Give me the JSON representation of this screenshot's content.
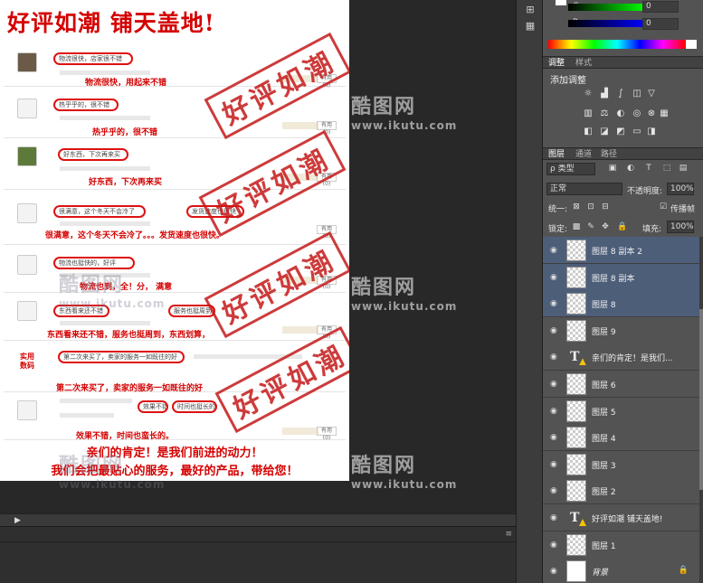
{
  "document": {
    "title": "好评如潮  铺天盖地!",
    "stamp_text": "好评如潮",
    "footer_line1": "亲们的肯定！是我们前进的动力！",
    "footer_line2": "我们会把最贴心的服务，最好的产品，带给您！",
    "reviews": [
      {
        "bubble": "物流很快，店家很不错",
        "note": "物流很快，用起来不错",
        "reply": "有用(0)"
      },
      {
        "bubble": "热乎乎的，很不错",
        "note": "热乎乎的，很不错",
        "reply": "有用(0)"
      },
      {
        "bubble": "好东西，下次再来买",
        "note": "好东西，下次再来买",
        "reply": "有用(0)"
      },
      {
        "bubble": "很满意，这个冬天不会冷了",
        "bubble2": "发货速度也很快",
        "note": "很满意，这个冬天不会冷了。。。发货速度也很快。",
        "reply": "有用(0)"
      },
      {
        "bubble": "物流也挺快的，好评",
        "note": "物流也到，全！分， 满意",
        "reply": "有用(0)"
      },
      {
        "bubble": "东西看来还不错",
        "bubble2": "服务也挺周到",
        "note": "东西看来还不错，服务也挺周到，东西划算，",
        "reply": "有用(0)"
      },
      {
        "bubble": "第二次来买了，卖家的服务一如既往的好",
        "note": "第二次来买了，卖家的服务一如既往的好",
        "reply": "有用(0)"
      },
      {
        "bubble": "效果不错",
        "bubble2": "时间也挺长的",
        "note": "效果不错，时间也蛮长的。",
        "reply": "有用(0)"
      }
    ]
  },
  "watermark": {
    "brand": "酷图网",
    "url": "www.ikutu.com"
  },
  "color_panel": {
    "g_label": "G",
    "g_value": "0",
    "b_label": "B",
    "b_value": "0"
  },
  "adjust_panel": {
    "tabs": [
      "调整",
      "样式"
    ],
    "title": "添加调整"
  },
  "layers_panel": {
    "tabs": [
      "图层",
      "通道",
      "路径"
    ],
    "kind_filter": "ρ 类型",
    "blend_mode": "正常",
    "opacity_label": "不透明度:",
    "opacity_value": "100%",
    "unify_label": "统一:",
    "propagate_label": "传播帧",
    "lock_label": "锁定:",
    "fill_label": "填充:",
    "fill_value": "100%",
    "layers": [
      {
        "name": "图层 8 副本 2",
        "type": "pixel",
        "selected": true
      },
      {
        "name": "图层 8 副本",
        "type": "pixel",
        "selected": true
      },
      {
        "name": "图层 8",
        "type": "pixel",
        "selected": true
      },
      {
        "name": "图层 9",
        "type": "pixel",
        "selected": false
      },
      {
        "name": "亲们的肯定！是我们...",
        "type": "text",
        "selected": false
      },
      {
        "name": "图层 6",
        "type": "pixel",
        "selected": false
      },
      {
        "name": "图层 5",
        "type": "pixel",
        "selected": false
      },
      {
        "name": "图层 4",
        "type": "pixel",
        "selected": false
      },
      {
        "name": "图层 3",
        "type": "pixel",
        "selected": false
      },
      {
        "name": "图层 2",
        "type": "pixel",
        "selected": false
      },
      {
        "name": "好评如潮 铺天盖地!",
        "type": "text",
        "selected": false
      },
      {
        "name": "图层 1",
        "type": "pixel",
        "selected": false
      },
      {
        "name": "背景",
        "type": "background",
        "selected": false
      }
    ]
  }
}
